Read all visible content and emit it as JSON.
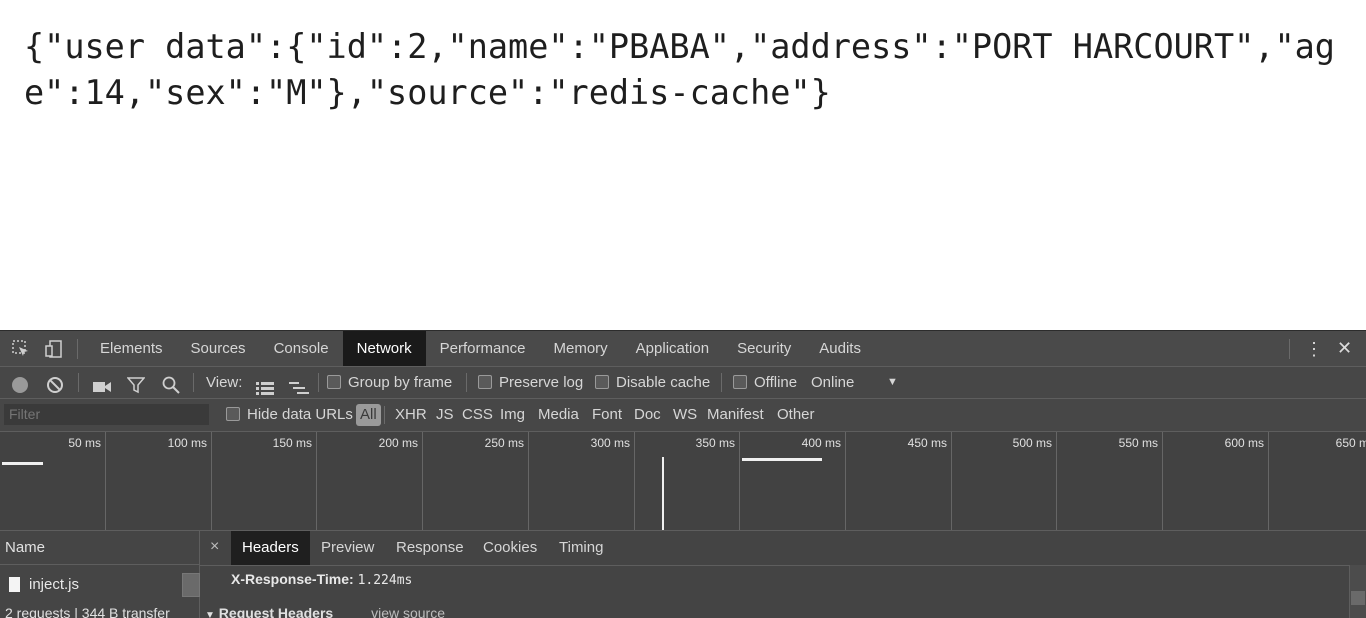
{
  "page": {
    "json_text": "{\"user data\":{\"id\":2,\"name\":\"PBABA\",\"address\":\"PORT HARCOURT\",\"age\":14,\"sex\":\"M\"},\"source\":\"redis-cache\"}"
  },
  "devtools": {
    "tabs": [
      "Elements",
      "Sources",
      "Console",
      "Network",
      "Performance",
      "Memory",
      "Application",
      "Security",
      "Audits"
    ],
    "active_tab": "Network",
    "icons": {
      "inspect": "inspect-element-icon",
      "device": "device-toolbar-icon",
      "more": "kebab-menu-icon",
      "close": "close-icon"
    },
    "toolbar": {
      "record_icon": "record-icon",
      "clear_icon": "clear-icon",
      "capture_icon": "video-camera-icon",
      "filter_icon": "funnel-icon",
      "search_icon": "search-icon",
      "view_label": "View:",
      "group_by_frame": "Group by frame",
      "preserve_log": "Preserve log",
      "disable_cache": "Disable cache",
      "offline": "Offline",
      "throttle_value": "Online"
    },
    "filter_bar": {
      "placeholder": "Filter",
      "hide_data_urls": "Hide data URLs",
      "types": [
        "All",
        "XHR",
        "JS",
        "CSS",
        "Img",
        "Media",
        "Font",
        "Doc",
        "WS",
        "Manifest",
        "Other"
      ],
      "active_type": "All"
    },
    "timeline": {
      "ticks": [
        "50 ms",
        "100 ms",
        "150 ms",
        "200 ms",
        "250 ms",
        "300 ms",
        "350 ms",
        "400 ms",
        "450 ms",
        "500 ms",
        "550 ms",
        "600 ms",
        "650 m"
      ]
    },
    "requests": {
      "column_header": "Name",
      "rows": [
        {
          "name": "inject.js"
        }
      ],
      "status": "2 requests | 344 B transfer"
    },
    "detail": {
      "close_label": "×",
      "tabs": [
        "Headers",
        "Preview",
        "Response",
        "Cookies",
        "Timing"
      ],
      "active_tab": "Headers",
      "header_name": "X-Response-Time:",
      "header_value": "1.224ms",
      "section_title": "Request Headers",
      "view_source": "view source"
    }
  }
}
